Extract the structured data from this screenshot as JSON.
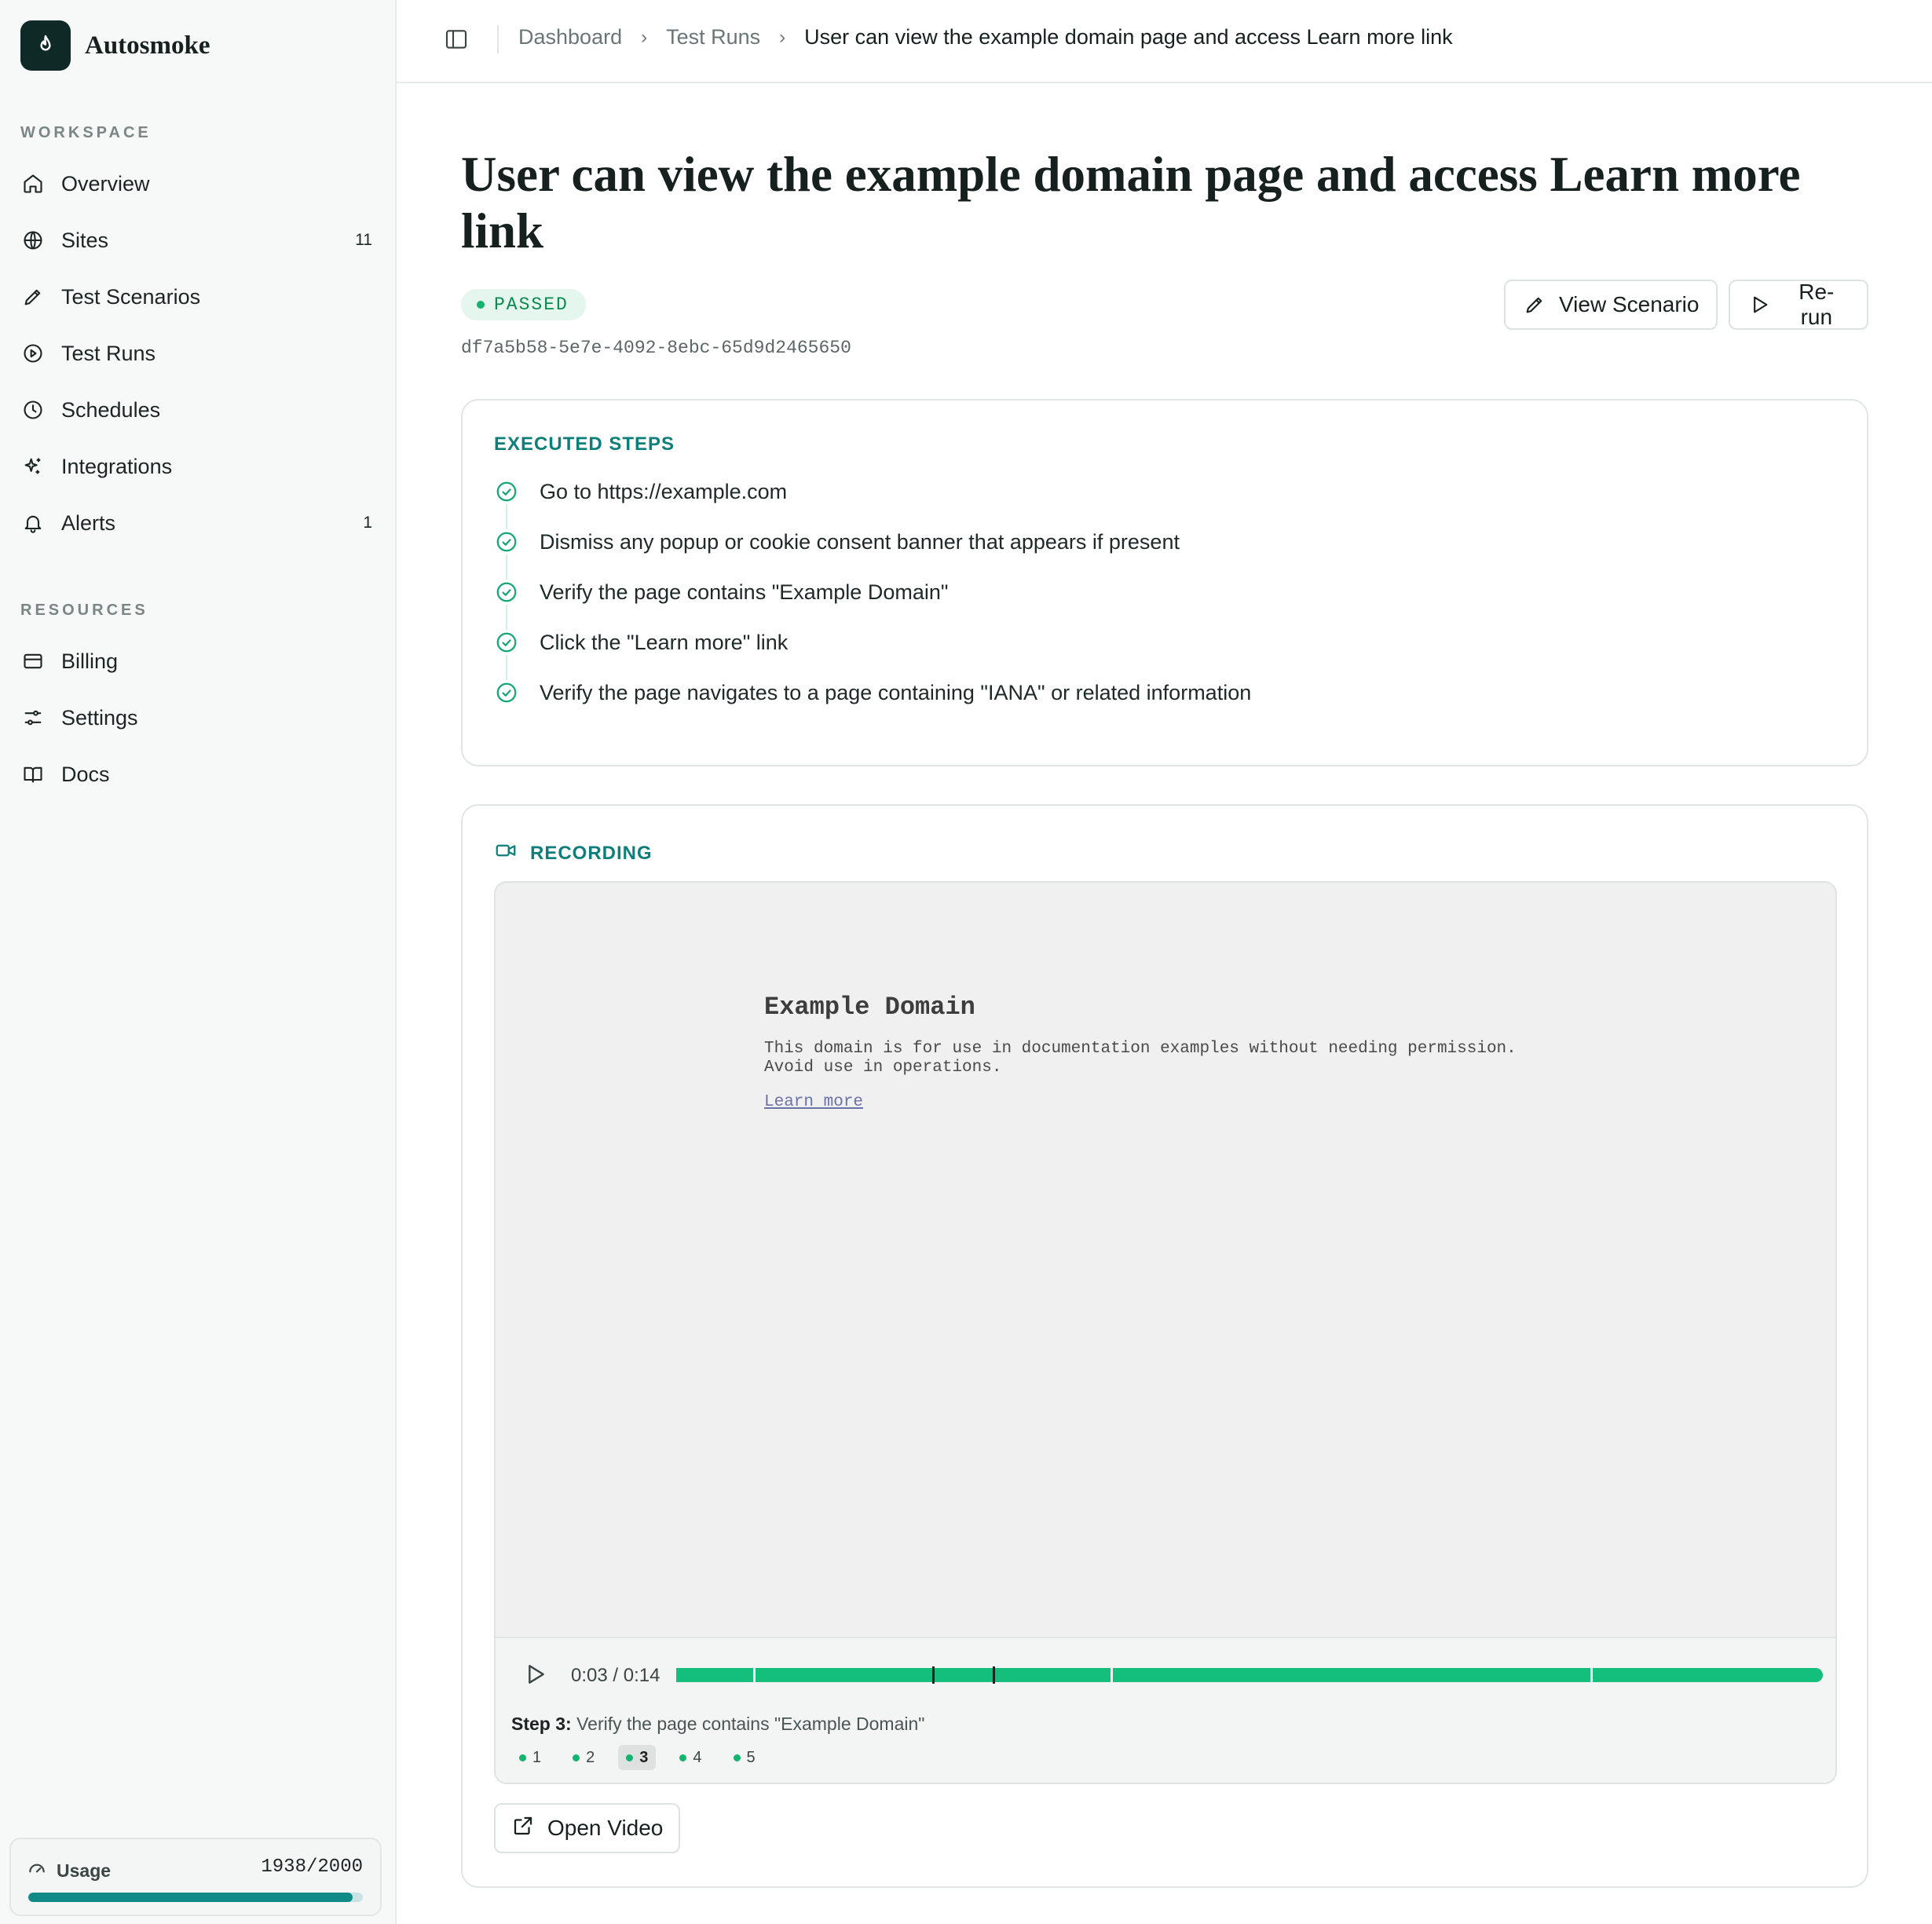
{
  "app": {
    "name": "Autosmoke"
  },
  "sidebar": {
    "workspace_label": "WORKSPACE",
    "workspace_items": [
      {
        "label": "Overview",
        "icon": "home-icon",
        "badge": ""
      },
      {
        "label": "Sites",
        "icon": "globe-icon",
        "badge": "11"
      },
      {
        "label": "Test Scenarios",
        "icon": "pencil-icon",
        "badge": ""
      },
      {
        "label": "Test Runs",
        "icon": "play-circle-icon",
        "badge": ""
      },
      {
        "label": "Schedules",
        "icon": "clock-icon",
        "badge": ""
      },
      {
        "label": "Integrations",
        "icon": "sparkle-icon",
        "badge": ""
      },
      {
        "label": "Alerts",
        "icon": "bell-icon",
        "badge": "1"
      }
    ],
    "resources_label": "RESOURCES",
    "resources_items": [
      {
        "label": "Billing",
        "icon": "credit-card-icon"
      },
      {
        "label": "Settings",
        "icon": "sliders-icon"
      },
      {
        "label": "Docs",
        "icon": "book-icon"
      }
    ],
    "usage": {
      "label": "Usage",
      "value": "1938/2000",
      "fraction": 0.969
    }
  },
  "breadcrumb": {
    "items": [
      "Dashboard",
      "Test Runs"
    ],
    "current": "User can view the example domain page and access Learn more link"
  },
  "run": {
    "title": "User can view the example domain page and access Learn more link",
    "status": "PASSED",
    "id": "df7a5b58-5e7e-4092-8ebc-65d9d2465650",
    "view_scenario_label": "View Scenario",
    "rerun_label": "Re-run"
  },
  "steps_card": {
    "heading": "EXECUTED STEPS",
    "steps": [
      "Go to https://example.com",
      "Dismiss any popup or cookie consent banner that appears if present",
      "Verify the page contains \"Example Domain\"",
      "Click the \"Learn more\" link",
      "Verify the page navigates to a page containing \"IANA\" or related information"
    ]
  },
  "recording": {
    "heading": "RECORDING",
    "preview": {
      "title": "Example Domain",
      "line1": "This domain is for use in documentation examples without needing permission.",
      "line2": "Avoid use in operations.",
      "link": "Learn more"
    },
    "time": "0:03 / 0:14",
    "current_seconds": 3,
    "duration_seconds": 14,
    "step_caption_prefix": "Step 3:",
    "step_caption_text": " Verify the page contains \"Example Domain\"",
    "chips": [
      "1",
      "2",
      "3",
      "4",
      "5"
    ],
    "active_chip": "3",
    "open_video_label": "Open Video",
    "colors": {
      "progress": "#13bf7a",
      "accent": "#0d7f7a"
    }
  }
}
